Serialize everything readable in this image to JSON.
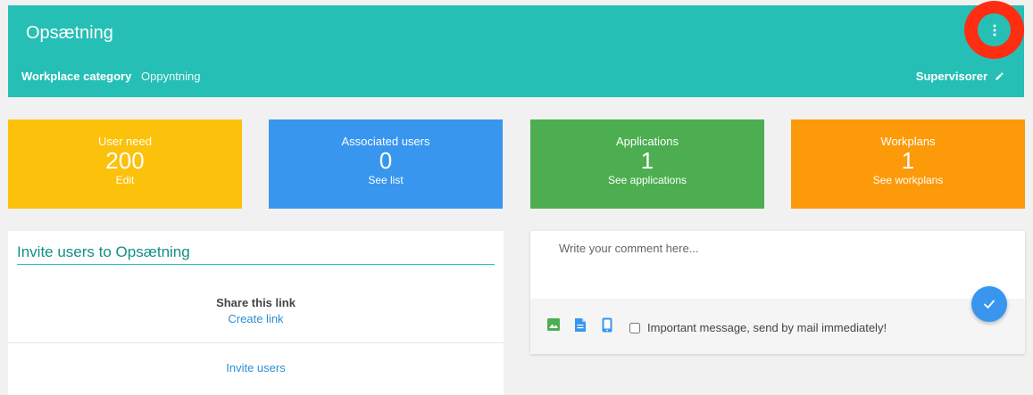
{
  "header": {
    "title": "Opsætning",
    "category_label": "Workplace category",
    "category_value": "Oppyntning",
    "supervisors_label": "Supervisorer",
    "menu_icon": "vertical-dots-icon",
    "edit_icon": "pencil-icon",
    "background_color": "#26bfb5",
    "highlight_color": "#ff2d12"
  },
  "stats": [
    {
      "label": "User need",
      "value": "200",
      "link": "Edit",
      "color": "#fcc10a"
    },
    {
      "label": "Associated users",
      "value": "0",
      "link": "See list",
      "color": "#3896ef"
    },
    {
      "label": "Applications",
      "value": "1",
      "link": "See applications",
      "color": "#4cae50"
    },
    {
      "label": "Workplans",
      "value": "1",
      "link": "See workplans",
      "color": "#fc9a0a"
    }
  ],
  "invite": {
    "title": "Invite users to Opsætning",
    "share_label": "Share this link",
    "create_link": "Create link",
    "invite_users": "Invite users"
  },
  "comment": {
    "placeholder": "Write your comment here...",
    "important_label": "Important message, send by mail immediately!",
    "important_checked": false,
    "icons": [
      "image-icon",
      "file-icon",
      "phone-icon"
    ],
    "submit_icon": "checkmark-icon"
  }
}
